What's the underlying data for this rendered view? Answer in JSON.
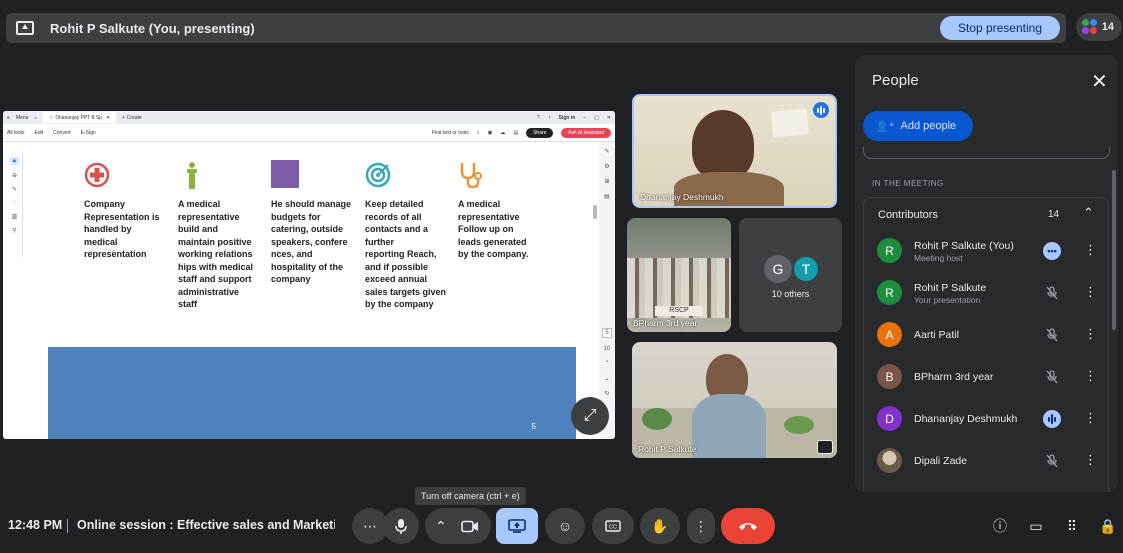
{
  "presenting": {
    "title": "Rohit P Salkute (You, presenting)",
    "stop_label": "Stop presenting",
    "participant_count": "14"
  },
  "shared_screen": {
    "browser": {
      "menu_label": "Menu",
      "tab_label": "Dhananjay PPT 8 Sp..",
      "new_tab_label": "+ Create",
      "signin_label": "Sign in"
    },
    "toolbar": {
      "items": [
        "All tools",
        "Edit",
        "Convert",
        "E-Sign"
      ],
      "find_label": "Find text or tools",
      "share_label": "Share",
      "ai_label": "Ask AI Assistant"
    },
    "page_box": "5",
    "page_total": "10",
    "slide": {
      "columns": [
        {
          "icon": "red-cross-icon",
          "lines": [
            "Company",
            "Representation is",
            "handled by",
            "medical",
            "representation"
          ]
        },
        {
          "icon": "person-podium-icon",
          "lines": [
            "A medical",
            "representative",
            "build and",
            "maintain positive",
            "working  relations",
            "hips with medical",
            "staff and support",
            "administrative",
            "staff"
          ]
        },
        {
          "icon": "purple-square-icon",
          "lines": [
            "He should manage",
            "budgets for",
            "catering, outside",
            "speakers, confere",
            "nces, and",
            "hospitality of the",
            "company"
          ]
        },
        {
          "icon": "target-icon",
          "lines": [
            "Keep detailed",
            "records of all",
            "contacts and a",
            "further",
            "reporting  Reach,",
            "and if possible",
            "exceed annual",
            "sales targets given",
            "by the  company"
          ]
        },
        {
          "icon": "stethoscope-icon",
          "lines": [
            "A medical",
            "representative",
            "Follow up on",
            "leads generated",
            "by the company."
          ]
        }
      ],
      "slide_number": "5"
    }
  },
  "tiles": {
    "dhananjay": "Dhananjay Deshmukh",
    "bpharm": "BPharm 3rd year",
    "bpharm_sign": "RSCP",
    "others_label": "10 others",
    "others_avatars": [
      {
        "letter": "G",
        "color": "#5f6368"
      },
      {
        "letter": "T",
        "color": "#129eaf"
      }
    ],
    "rohit": "Rohit P Salkute"
  },
  "people_panel": {
    "title": "People",
    "add_label": "Add people",
    "section_label": "IN THE MEETING",
    "contributors_label": "Contributors",
    "contributors_count": "14",
    "people": [
      {
        "initial": "R",
        "color": "#1e8e3e",
        "name": "Rohit P Salkute (You)",
        "sub": "Meeting host",
        "status": "more"
      },
      {
        "initial": "R",
        "color": "#1e8e3e",
        "name": "Rohit P Salkute",
        "sub": "Your presentation",
        "status": "muted"
      },
      {
        "initial": "A",
        "color": "#e8710a",
        "name": "Aarti Patil",
        "sub": "",
        "status": "muted"
      },
      {
        "initial": "B",
        "color": "#795548",
        "name": "BPharm 3rd year",
        "sub": "",
        "status": "muted"
      },
      {
        "initial": "D",
        "color": "#8430ce",
        "name": "Dhananjay Deshmukh",
        "sub": "",
        "status": "speaking"
      },
      {
        "initial": "",
        "color": "#7a6a55",
        "name": "Dipali Zade",
        "sub": "",
        "status": "muted"
      }
    ]
  },
  "tooltip": "Turn off camera (ctrl + e)",
  "bottom": {
    "time": "12:48 PM",
    "meeting_name": "Online session : Effective sales and Marketi..."
  },
  "colors": {
    "stop_btn": "#a8c7fa",
    "end_call": "#ea4335",
    "add_people": "#0b57d0",
    "slide_bar": "#4f81bd"
  }
}
